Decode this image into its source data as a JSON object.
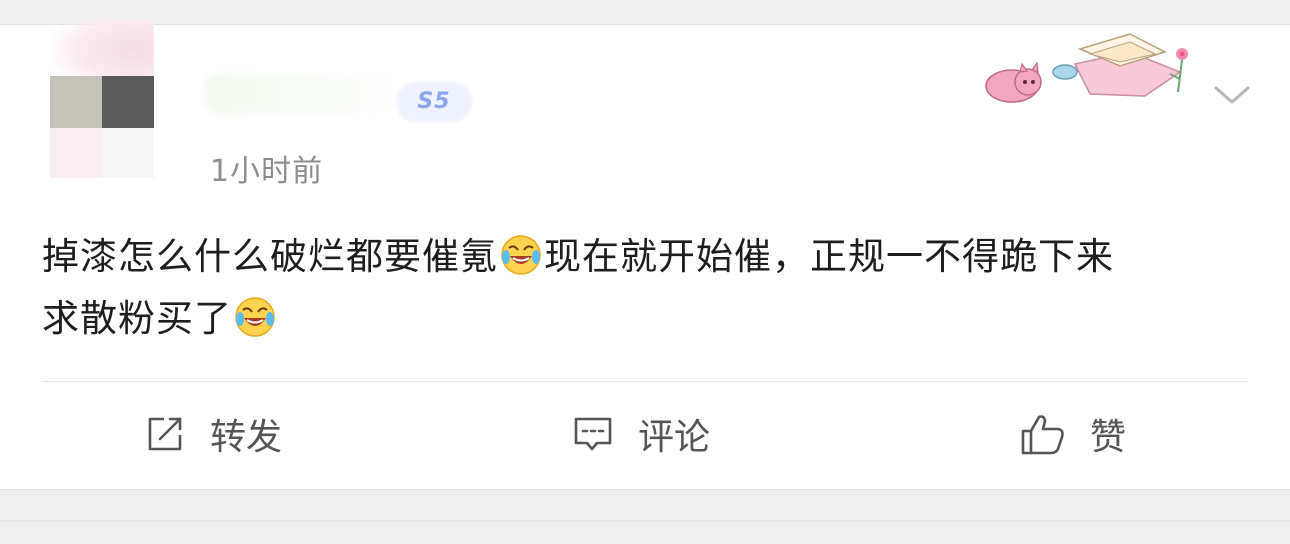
{
  "post": {
    "time": "1小时前",
    "badge": "S5",
    "text_line1_a": "掉漆怎么什么破烂都要催氪",
    "text_line1_b": "现在就开始催，正规一不得跪下来",
    "text_line2": "求散粉买了",
    "emoji_name": "laughing-crying-emoji"
  },
  "actions": {
    "repost_label": "转发",
    "comment_label": "评论",
    "like_label": "赞"
  },
  "colors": {
    "text": "#1e1e1e",
    "muted": "#8c8c8c",
    "badge": "#8aa5f0",
    "icon": "#555555"
  }
}
